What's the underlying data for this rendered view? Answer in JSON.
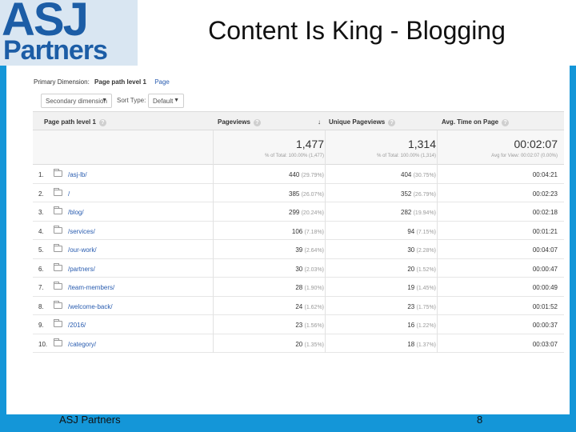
{
  "logo": {
    "line1": "ASJ",
    "line2": "Partners"
  },
  "slide": {
    "title": "Content Is King - Blogging",
    "footer_left": "ASJ Partners",
    "page_number": "8"
  },
  "analytics": {
    "primary_dimension_label": "Primary Dimension:",
    "primary_dimension_value": "Page path level 1",
    "primary_dimension_link": "Page",
    "secondary_dimension": "Secondary dimension",
    "sort_type_label": "Sort Type:",
    "sort_type_value": "Default",
    "columns": [
      "Page path level 1",
      "Pageviews",
      "Unique Pageviews",
      "Avg. Time on Page"
    ],
    "sort_indicator": "↓",
    "totals": {
      "pageviews": "1,477",
      "pageviews_sub": "% of Total: 100.00% (1,477)",
      "unique": "1,314",
      "unique_sub": "% of Total: 100.00% (1,314)",
      "avg_time": "00:02:07",
      "avg_time_sub": "Avg for View: 00:02:07 (0.00%)"
    },
    "rows": [
      {
        "idx": "1.",
        "path": "/asj-lb/",
        "pv": "440",
        "pv_pct": "(29.79%)",
        "upv": "404",
        "upv_pct": "(30.75%)",
        "time": "00:04:21"
      },
      {
        "idx": "2.",
        "path": "/",
        "pv": "385",
        "pv_pct": "(26.07%)",
        "upv": "352",
        "upv_pct": "(26.79%)",
        "time": "00:02:23"
      },
      {
        "idx": "3.",
        "path": "/blog/",
        "pv": "299",
        "pv_pct": "(20.24%)",
        "upv": "282",
        "upv_pct": "(19.94%)",
        "time": "00:02:18"
      },
      {
        "idx": "4.",
        "path": "/services/",
        "pv": "106",
        "pv_pct": "(7.18%)",
        "upv": "94",
        "upv_pct": "(7.15%)",
        "time": "00:01:21"
      },
      {
        "idx": "5.",
        "path": "/our-work/",
        "pv": "39",
        "pv_pct": "(2.64%)",
        "upv": "30",
        "upv_pct": "(2.28%)",
        "time": "00:04:07"
      },
      {
        "idx": "6.",
        "path": "/partners/",
        "pv": "30",
        "pv_pct": "(2.03%)",
        "upv": "20",
        "upv_pct": "(1.52%)",
        "time": "00:00:47"
      },
      {
        "idx": "7.",
        "path": "/team-members/",
        "pv": "28",
        "pv_pct": "(1.90%)",
        "upv": "19",
        "upv_pct": "(1.45%)",
        "time": "00:00:49"
      },
      {
        "idx": "8.",
        "path": "/welcome-back/",
        "pv": "24",
        "pv_pct": "(1.62%)",
        "upv": "23",
        "upv_pct": "(1.75%)",
        "time": "00:01:52"
      },
      {
        "idx": "9.",
        "path": "/2016/",
        "pv": "23",
        "pv_pct": "(1.56%)",
        "upv": "16",
        "upv_pct": "(1.22%)",
        "time": "00:00:37"
      },
      {
        "idx": "10.",
        "path": "/category/",
        "pv": "20",
        "pv_pct": "(1.35%)",
        "upv": "18",
        "upv_pct": "(1.37%)",
        "time": "00:03:07"
      }
    ]
  }
}
